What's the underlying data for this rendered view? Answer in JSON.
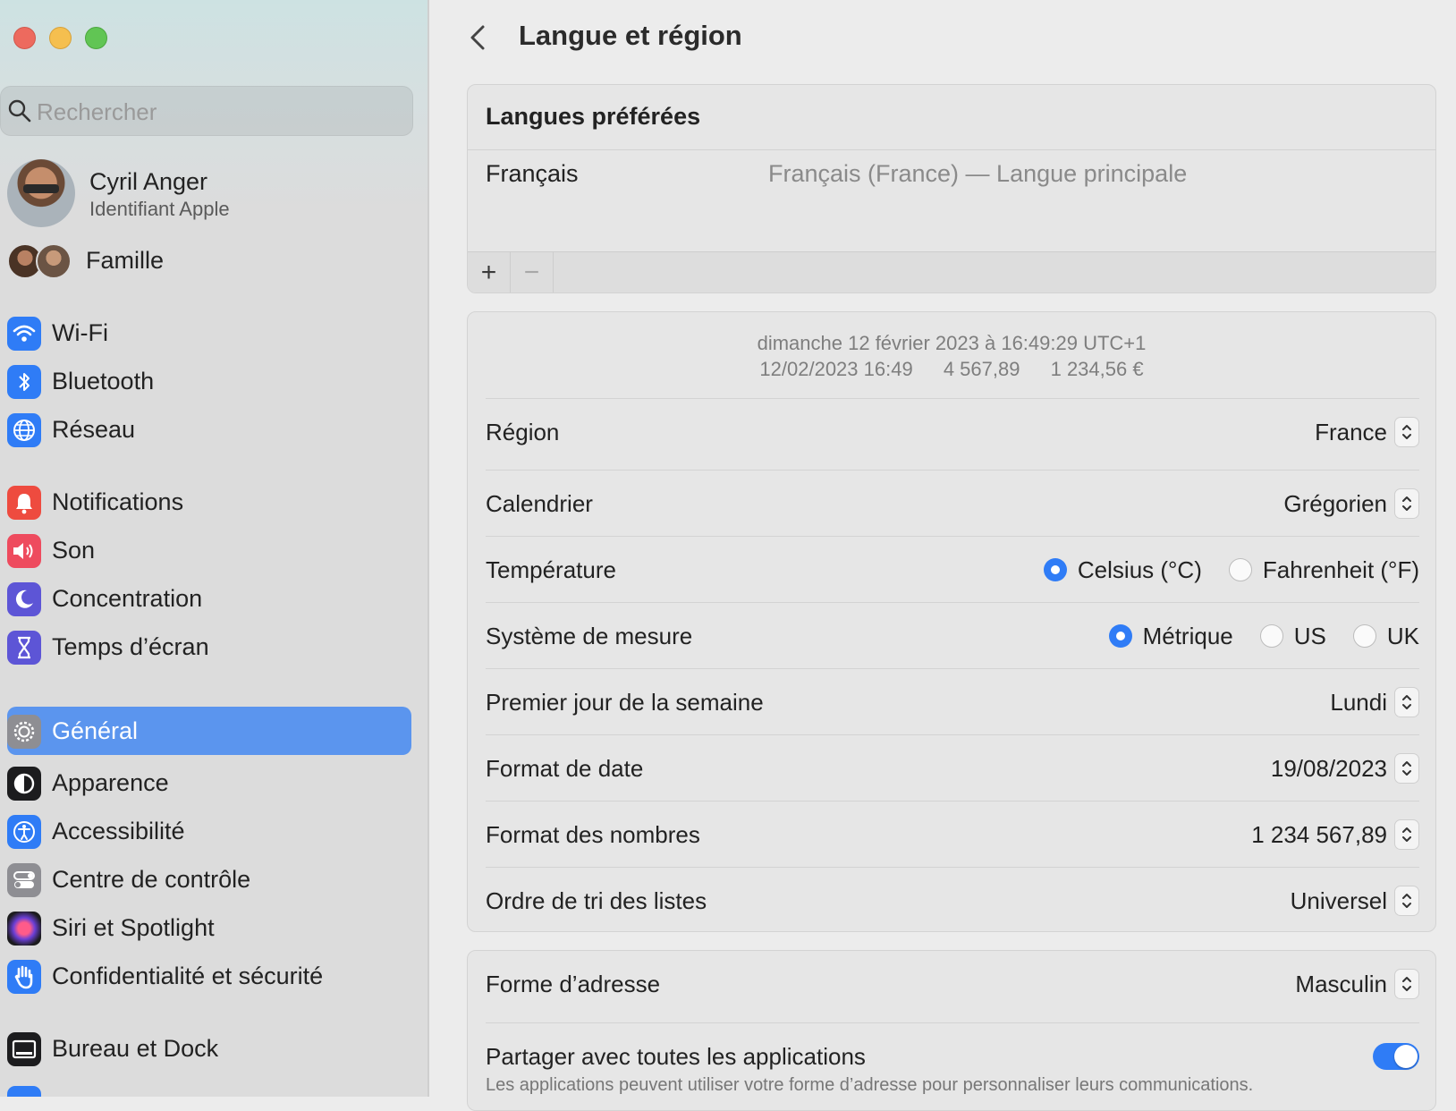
{
  "sidebar": {
    "search_placeholder": "Rechercher",
    "account": {
      "name": "Cyril Anger",
      "subtitle": "Identifiant Apple"
    },
    "family_label": "Famille",
    "items": [
      {
        "label": "Wi-Fi",
        "icon": "wifi-icon",
        "color": "#2f7cf6"
      },
      {
        "label": "Bluetooth",
        "icon": "bluetooth-icon",
        "color": "#2f7cf6"
      },
      {
        "label": "Réseau",
        "icon": "globe-icon",
        "color": "#2f7cf6"
      },
      {
        "label": "Notifications",
        "icon": "bell-icon",
        "color": "#ee4b3f"
      },
      {
        "label": "Son",
        "icon": "speaker-icon",
        "color": "#ee4b5e"
      },
      {
        "label": "Concentration",
        "icon": "moon-icon",
        "color": "#5d55d6"
      },
      {
        "label": "Temps d’écran",
        "icon": "hourglass-icon",
        "color": "#5d55d6"
      },
      {
        "label": "Général",
        "icon": "gear-icon",
        "color": "#8e8e93",
        "selected": true
      },
      {
        "label": "Apparence",
        "icon": "appearance-icon",
        "color": "#1c1c1e"
      },
      {
        "label": "Accessibilité",
        "icon": "accessibility-icon",
        "color": "#2f7cf6"
      },
      {
        "label": "Centre de contrôle",
        "icon": "toggles-icon",
        "color": "#8e8e93"
      },
      {
        "label": "Siri et Spotlight",
        "icon": "siri-icon",
        "color": "#7a3fb8"
      },
      {
        "label": "Confidentialité et sécurité",
        "icon": "hand-icon",
        "color": "#2f7cf6"
      },
      {
        "label": "Bureau et Dock",
        "icon": "dock-icon",
        "color": "#1c1c1e"
      }
    ]
  },
  "main": {
    "title": "Langue et région",
    "languages": {
      "header": "Langues préférées",
      "items": [
        {
          "name": "Français",
          "description": "Français (France) — Langue principale"
        }
      ],
      "add_label": "+",
      "remove_label": "−"
    },
    "preview": {
      "line1": "dimanche 12 février 2023 à 16:49:29 UTC+1",
      "date": "12/02/2023 16:49",
      "number": "4 567,89",
      "currency": "1 234,56 €"
    },
    "settings": {
      "region": {
        "label": "Région",
        "value": "France"
      },
      "calendar": {
        "label": "Calendrier",
        "value": "Grégorien"
      },
      "temperature": {
        "label": "Température",
        "options": [
          "Celsius (°C)",
          "Fahrenheit (°F)"
        ],
        "selected": "Celsius (°C)"
      },
      "measurement": {
        "label": "Système de mesure",
        "options": [
          "Métrique",
          "US",
          "UK"
        ],
        "selected": "Métrique"
      },
      "first_day": {
        "label": "Premier jour de la semaine",
        "value": "Lundi"
      },
      "date_format": {
        "label": "Format de date",
        "value": "19/08/2023"
      },
      "number_format": {
        "label": "Format des nombres",
        "value": "1 234 567,89"
      },
      "sort_order": {
        "label": "Ordre de tri des listes",
        "value": "Universel"
      }
    },
    "address": {
      "label": "Forme d’adresse",
      "value": "Masculin",
      "share_label": "Partager avec toutes les applications",
      "share_description": "Les applications peuvent utiliser votre forme d’adresse pour personnaliser leurs communications.",
      "share_enabled": true
    }
  },
  "colors": {
    "accent": "#2f7cf6",
    "selection": "#5b95ee"
  }
}
